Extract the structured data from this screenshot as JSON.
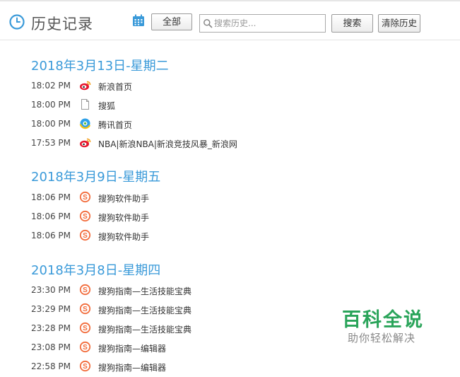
{
  "header": {
    "title": "历史记录",
    "all_label": "全部",
    "search_placeholder": "搜索历史...",
    "search_label": "搜索",
    "clear_label": "清除历史"
  },
  "groups": [
    {
      "date": "2018年3月13日-星期二",
      "entries": [
        {
          "time": "18:02 PM",
          "icon": "weibo-icon",
          "title": "新浪首页"
        },
        {
          "time": "18:00 PM",
          "icon": "page-icon",
          "title": "搜狐"
        },
        {
          "time": "18:00 PM",
          "icon": "qq-browser-icon",
          "title": "腾讯首页"
        },
        {
          "time": "17:53 PM",
          "icon": "weibo-icon",
          "title": "NBA|新浪NBA|新浪竞技风暴_新浪网"
        }
      ]
    },
    {
      "date": "2018年3月9日-星期五",
      "entries": [
        {
          "time": "18:06 PM",
          "icon": "sogou-icon",
          "title": "搜狗软件助手"
        },
        {
          "time": "18:06 PM",
          "icon": "sogou-icon",
          "title": "搜狗软件助手"
        },
        {
          "time": "18:06 PM",
          "icon": "sogou-icon",
          "title": "搜狗软件助手"
        }
      ]
    },
    {
      "date": "2018年3月8日-星期四",
      "entries": [
        {
          "time": "23:30 PM",
          "icon": "sogou-icon",
          "title": "搜狗指南—生活技能宝典"
        },
        {
          "time": "23:29 PM",
          "icon": "sogou-icon",
          "title": "搜狗指南—生活技能宝典"
        },
        {
          "time": "23:28 PM",
          "icon": "sogou-icon",
          "title": "搜狗指南—生活技能宝典"
        },
        {
          "time": "23:08 PM",
          "icon": "sogou-icon",
          "title": "搜狗指南—编辑器"
        },
        {
          "time": "22:58 PM",
          "icon": "sogou-icon",
          "title": "搜狗指南—编辑器"
        }
      ]
    }
  ],
  "watermark": {
    "main": "百科全说",
    "sub": "助你轻松解决"
  },
  "colors": {
    "accent": "#3a9ad9",
    "watermark_green": "#2aa45a"
  }
}
